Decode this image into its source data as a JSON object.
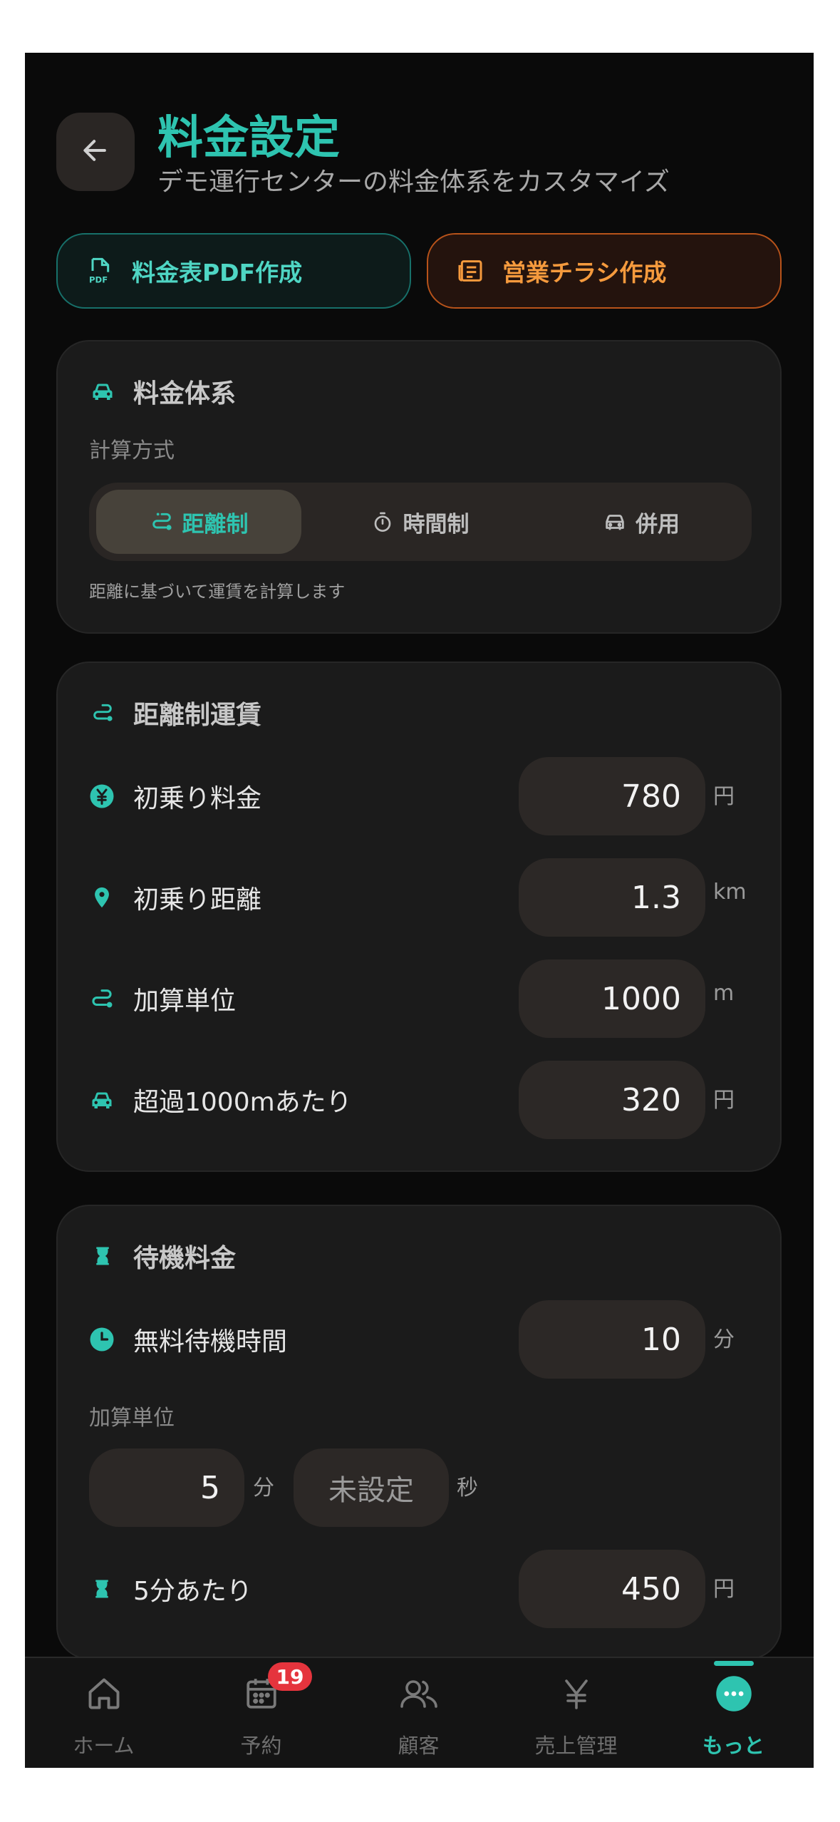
{
  "header": {
    "title": "料金設定",
    "subtitle": "デモ運行センターの料金体系をカスタマイズ"
  },
  "actions": {
    "pdf_label": "料金表PDF作成",
    "flyer_label": "営業チラシ作成"
  },
  "pricing_system": {
    "title": "料金体系",
    "calc_method_label": "計算方式",
    "options": [
      {
        "label": "距離制",
        "icon": "route-icon",
        "selected": true
      },
      {
        "label": "時間制",
        "icon": "timer-icon",
        "selected": false
      },
      {
        "label": "併用",
        "icon": "car-icon",
        "selected": false
      }
    ],
    "description": "距離に基づいて運賃を計算します"
  },
  "distance_fare": {
    "title": "距離制運賃",
    "rows": [
      {
        "label": "初乗り料金",
        "value": "780",
        "unit": "円",
        "icon": "yen-circle-icon"
      },
      {
        "label": "初乗り距離",
        "value": "1.3",
        "unit": "km",
        "icon": "location-pin-icon"
      },
      {
        "label": "加算単位",
        "value": "1000",
        "unit": "m",
        "icon": "route-icon"
      },
      {
        "label": "超過1000mあたり",
        "value": "320",
        "unit": "円",
        "icon": "car-icon"
      }
    ]
  },
  "waiting_fare": {
    "title": "待機料金",
    "free_wait": {
      "label": "無料待機時間",
      "value": "10",
      "unit": "分",
      "icon": "clock-icon"
    },
    "increment_label": "加算単位",
    "increment_minutes": {
      "value": "5",
      "unit": "分"
    },
    "increment_seconds": {
      "placeholder": "未設定",
      "unit": "秒"
    },
    "per_unit": {
      "label": "5分あたり",
      "value": "450",
      "unit": "円",
      "icon": "hourglass-icon"
    }
  },
  "nav": {
    "items": [
      {
        "label": "ホーム",
        "icon": "home-icon",
        "active": false
      },
      {
        "label": "予約",
        "icon": "calendar-icon",
        "active": false,
        "badge": "19"
      },
      {
        "label": "顧客",
        "icon": "users-icon",
        "active": false
      },
      {
        "label": "売上管理",
        "icon": "yen-icon",
        "active": false
      },
      {
        "label": "もっと",
        "icon": "more-icon",
        "active": true
      }
    ]
  },
  "colors": {
    "accent": "#2ec4b0",
    "orange": "#f59a3d",
    "background": "#0a0a0a",
    "card": "#1b1b1b",
    "badge": "#e5343d"
  }
}
